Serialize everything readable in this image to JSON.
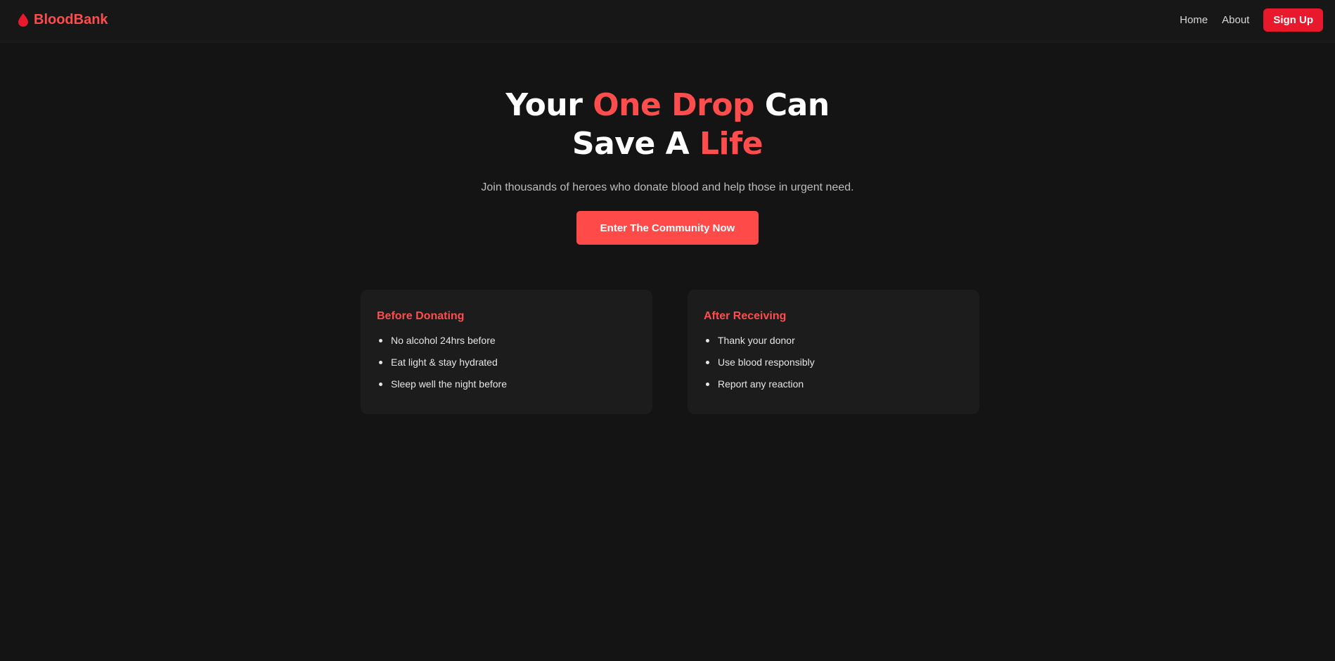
{
  "nav": {
    "brand": "BloodBank",
    "brand_icon": "blood-drop-icon",
    "links": [
      "Home",
      "About"
    ],
    "signup_label": "Sign Up"
  },
  "hero": {
    "title_part1": "Your ",
    "title_accent1": "One Drop",
    "title_part2": " Can",
    "title_part3": "Save A ",
    "title_accent2": "Life",
    "subtitle": "Join thousands of heroes who donate blood and help those in urgent need.",
    "cta_label": "Enter The Community Now"
  },
  "cards": [
    {
      "title": "Before Donating",
      "items": [
        "No alcohol 24hrs before",
        "Eat light & stay hydrated",
        "Sleep well the night before"
      ]
    },
    {
      "title": "After Receiving",
      "items": [
        "Thank your donor",
        "Use blood responsibly",
        "Report any reaction"
      ]
    }
  ],
  "colors": {
    "accent": "#ff4d4d",
    "signup": "#e8192c",
    "background": "#141414",
    "card": "#1c1c1c"
  }
}
